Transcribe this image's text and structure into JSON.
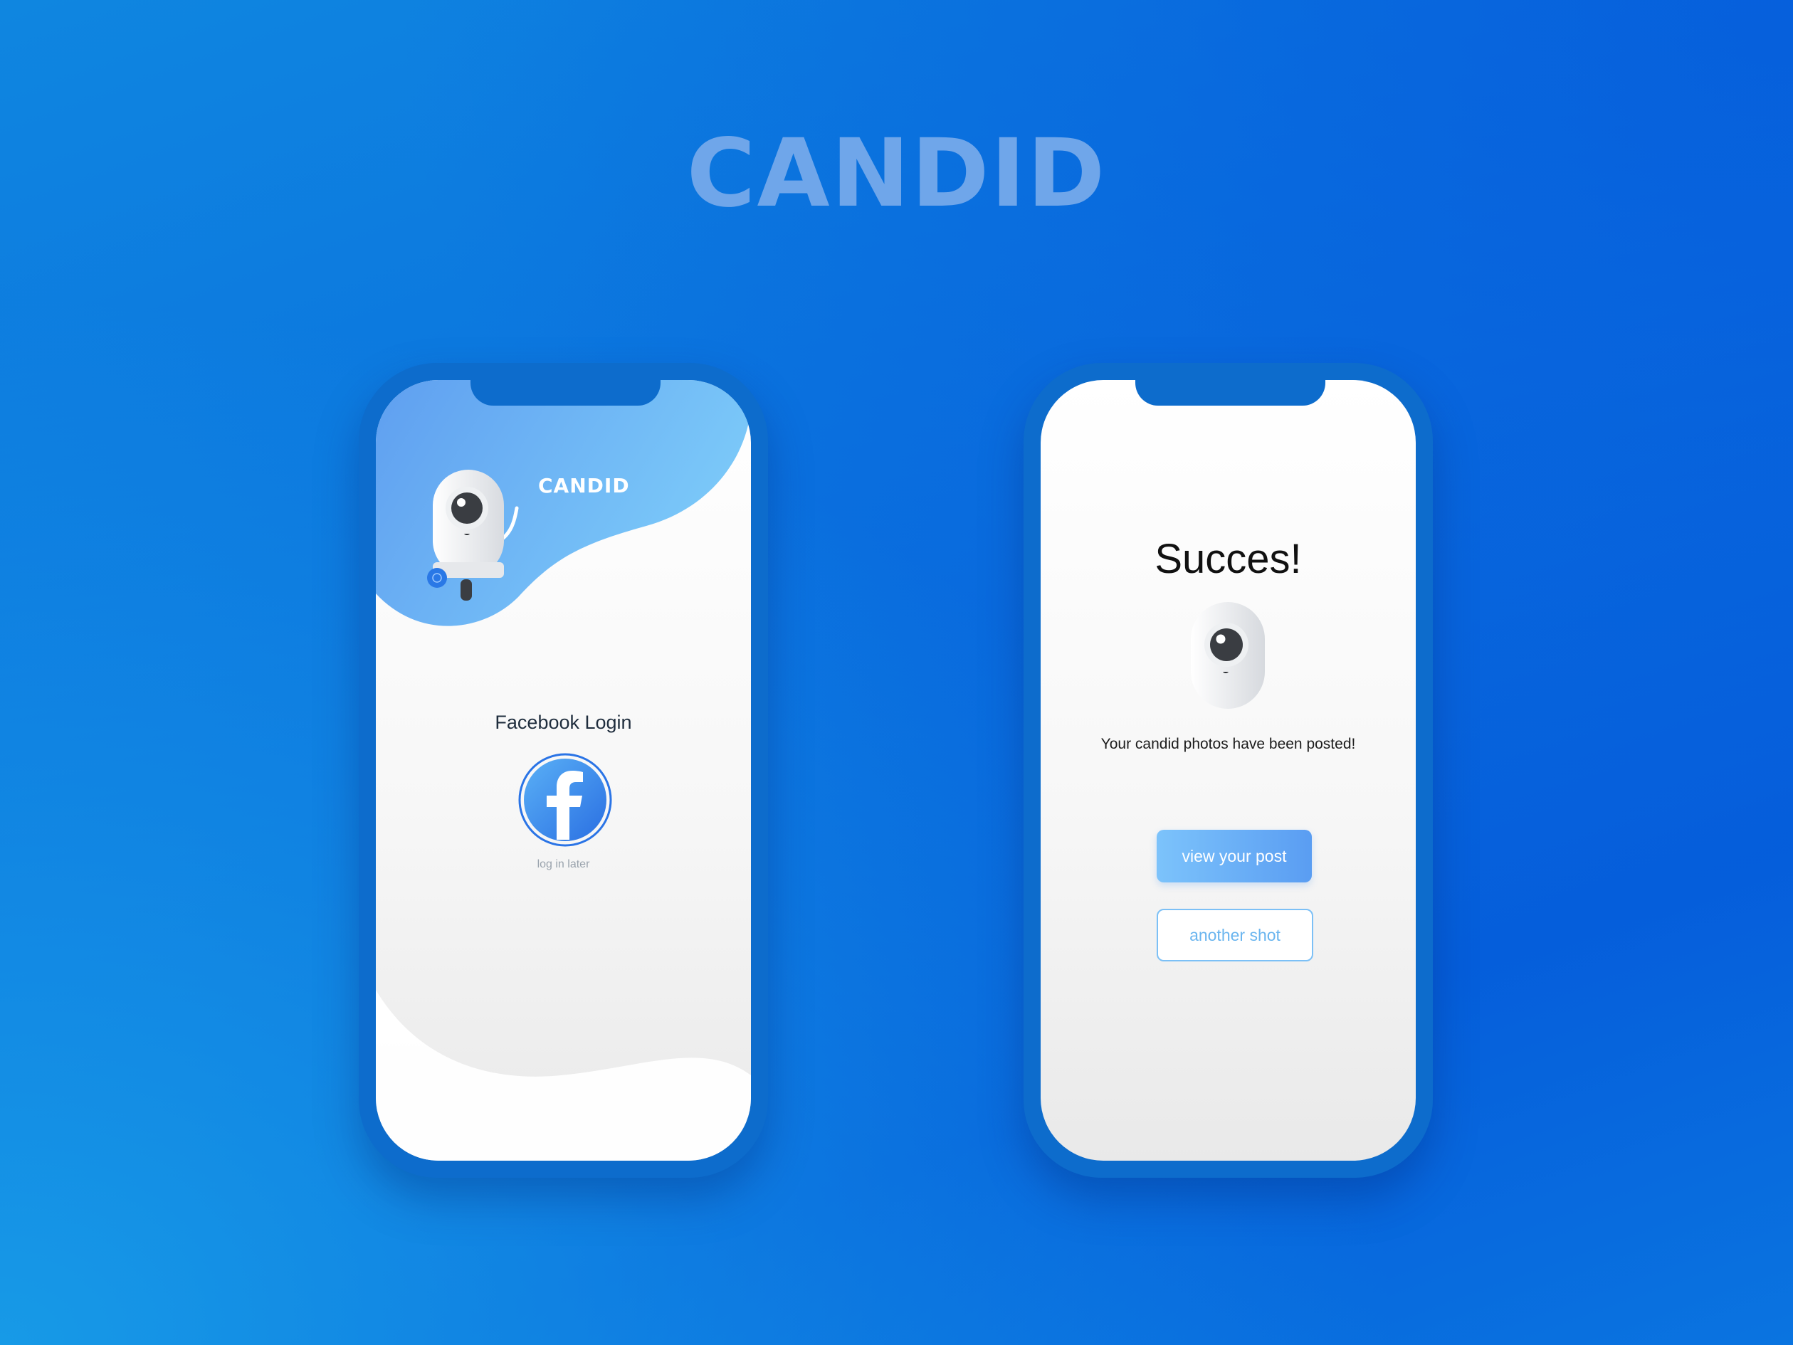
{
  "hero": {
    "title": "CANDID"
  },
  "login_screen": {
    "brand": "CANDID",
    "facebook_label": "Facebook Login",
    "log_in_later": "log in later"
  },
  "success_screen": {
    "title": "Succes!",
    "message": "Your candid photos have been posted!",
    "view_post_button": "view your post",
    "another_shot_button": "another shot"
  },
  "colors": {
    "background_top": "#0a6fde",
    "phone_frame": "#0d6ccc",
    "accent_blue": "#5a9df2",
    "light_blue": "#7cc3fb",
    "title_tint": "#6fa6ea"
  }
}
